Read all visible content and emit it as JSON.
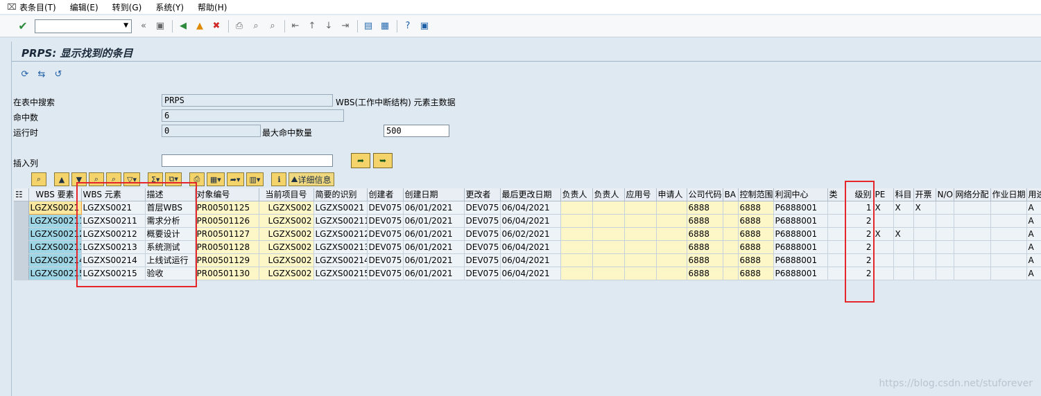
{
  "menu": {
    "items": [
      "表条目(T)",
      "编辑(E)",
      "转到(G)",
      "系统(Y)",
      "帮助(H)"
    ]
  },
  "window": {
    "title": "PRPS: 显示找到的条目"
  },
  "fields": {
    "search_table_label": "在表中搜索",
    "search_table_value": "PRPS",
    "search_table_desc": "WBS(工作中断结构) 元素主数据",
    "hits_label": "命中数",
    "hits_value": "6",
    "runtime_label": "运行时",
    "runtime_value": "0",
    "max_hits_label": "最大命中数量",
    "max_hits_value": "500",
    "insert_col_label": "插入列",
    "insert_col_value": ""
  },
  "grid_toolbar": {
    "detail_label": "详细信息"
  },
  "table": {
    "columns": [
      "WBS 要素",
      "WBS 元素",
      "描述",
      "对象编号",
      "当前项目号",
      "简要的识别",
      "创建者",
      "创建日期",
      "更改者",
      "最后更改日期",
      "负责人",
      "负责人",
      "应用号",
      "申请人",
      "公司代码",
      "BA",
      "控制范围",
      "利润中心",
      "类",
      "级别",
      "PE",
      "科目",
      "开票",
      "N/O",
      "网络分配",
      "作业日期",
      "用途"
    ],
    "rows": [
      [
        "LGZXS0021",
        "LGZXS0021",
        "首层WBS",
        "PR00501125",
        "LGZXS002",
        "LGZXS0021",
        "DEV075",
        "06/01/2021",
        "DEV075",
        "06/04/2021",
        "",
        "",
        "",
        "",
        "6888",
        "",
        "6888",
        "P6888001",
        "",
        "1",
        "X",
        "X",
        "X",
        "",
        "",
        "",
        "A"
      ],
      [
        "LGZXS00211",
        "LGZXS00211",
        "需求分析",
        "PR00501126",
        "LGZXS002",
        "LGZXS00211",
        "DEV075",
        "06/01/2021",
        "DEV075",
        "06/04/2021",
        "",
        "",
        "",
        "",
        "6888",
        "",
        "6888",
        "P6888001",
        "",
        "2",
        "",
        "",
        "",
        "",
        "",
        "",
        "A"
      ],
      [
        "LGZXS00212",
        "LGZXS00212",
        "概要设计",
        "PR00501127",
        "LGZXS002",
        "LGZXS00212",
        "DEV075",
        "06/01/2021",
        "DEV075",
        "06/02/2021",
        "",
        "",
        "",
        "",
        "6888",
        "",
        "6888",
        "P6888001",
        "",
        "2",
        "X",
        "X",
        "",
        "",
        "",
        "",
        "A"
      ],
      [
        "LGZXS00213",
        "LGZXS00213",
        "系统测试",
        "PR00501128",
        "LGZXS002",
        "LGZXS00213",
        "DEV075",
        "06/01/2021",
        "DEV075",
        "06/04/2021",
        "",
        "",
        "",
        "",
        "6888",
        "",
        "6888",
        "P6888001",
        "",
        "2",
        "",
        "",
        "",
        "",
        "",
        "",
        "A"
      ],
      [
        "LGZXS00214",
        "LGZXS00214",
        "上线试运行",
        "PR00501129",
        "LGZXS002",
        "LGZXS00214",
        "DEV075",
        "06/01/2021",
        "DEV075",
        "06/04/2021",
        "",
        "",
        "",
        "",
        "6888",
        "",
        "6888",
        "P6888001",
        "",
        "2",
        "",
        "",
        "",
        "",
        "",
        "",
        "A"
      ],
      [
        "LGZXS00215",
        "LGZXS00215",
        "验收",
        "PR00501130",
        "LGZXS002",
        "LGZXS00215",
        "DEV075",
        "06/01/2021",
        "DEV075",
        "06/04/2021",
        "",
        "",
        "",
        "",
        "6888",
        "",
        "6888",
        "P6888001",
        "",
        "2",
        "",
        "",
        "",
        "",
        "",
        "",
        "A"
      ]
    ]
  },
  "watermark": "https://blog.csdn.net/stuforever"
}
